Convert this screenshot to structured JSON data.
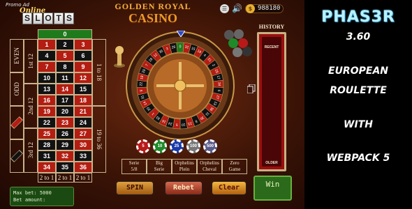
{
  "logo": {
    "promo": "Promo Ad",
    "script": "Online",
    "reels": [
      "S",
      "L",
      "O",
      "T",
      "S"
    ]
  },
  "title": {
    "line1": "GOLDEN ROYAL",
    "line2": "CASINO"
  },
  "topbar": {
    "menu_icon": "menu-icon",
    "sound_icon": "speaker-icon",
    "coin_icon": "$",
    "balance": "988180"
  },
  "table": {
    "zero": "0",
    "rows": [
      [
        "1",
        "2",
        "3"
      ],
      [
        "4",
        "5",
        "6"
      ],
      [
        "7",
        "8",
        "9"
      ],
      [
        "10",
        "11",
        "12"
      ],
      [
        "13",
        "14",
        "15"
      ],
      [
        "16",
        "17",
        "18"
      ],
      [
        "19",
        "20",
        "21"
      ],
      [
        "22",
        "23",
        "24"
      ],
      [
        "25",
        "26",
        "27"
      ],
      [
        "28",
        "29",
        "30"
      ],
      [
        "31",
        "32",
        "33"
      ],
      [
        "34",
        "35",
        "36"
      ]
    ],
    "reds": [
      "1",
      "3",
      "5",
      "7",
      "9",
      "12",
      "14",
      "16",
      "18",
      "19",
      "21",
      "23",
      "25",
      "27",
      "30",
      "32",
      "34",
      "36"
    ],
    "columns": [
      "2 to 1",
      "2 to 1",
      "2 to 1"
    ],
    "dozens": [
      "1st 12",
      "2nd 12",
      "3rd 12"
    ],
    "halves": [
      "1 to 18",
      "19 to 36"
    ],
    "even": "EVEN",
    "odd": "ODD"
  },
  "wheel": {
    "numbers": [
      "0",
      "32",
      "15",
      "19",
      "4",
      "21",
      "2",
      "25",
      "17",
      "34",
      "6",
      "27",
      "13",
      "36",
      "11",
      "30",
      "8",
      "23",
      "10",
      "5",
      "24",
      "16",
      "33",
      "1",
      "20",
      "14",
      "31",
      "9",
      "22",
      "18",
      "29",
      "7",
      "28",
      "12",
      "35",
      "3",
      "26"
    ]
  },
  "chips": [
    {
      "label": "5",
      "color": "#b81a1a"
    },
    {
      "label": "10",
      "color": "#1f8a2a"
    },
    {
      "label": "25",
      "color": "#1a3aa8"
    },
    {
      "label": "100",
      "color": "#777777"
    },
    {
      "label": "500",
      "color": "#5a5a8a"
    }
  ],
  "special_bets": [
    {
      "line1": "Serie",
      "line2": "5/8"
    },
    {
      "line1": "Big",
      "line2": "Serie"
    },
    {
      "line1": "Orphelins",
      "line2": "Plein"
    },
    {
      "line1": "Orphelins",
      "line2": "Cheval"
    },
    {
      "line1": "Zero",
      "line2": "Game"
    }
  ],
  "buttons": {
    "spin": "SPIN",
    "rebet": "Rebet",
    "clear": "Clear"
  },
  "win": "Win",
  "bet_info": {
    "max_bet": "Max bet: 5000",
    "bet_amount": "Bet amount:"
  },
  "history": {
    "title": "HISTORY",
    "recent": "RECENT",
    "older": "OLDER"
  },
  "sidebar": {
    "brand": "PHAS3R",
    "version": "3.60",
    "lines": [
      "EUROPEAN",
      "ROULETTE",
      "WITH",
      "WEBPACK 5"
    ]
  }
}
